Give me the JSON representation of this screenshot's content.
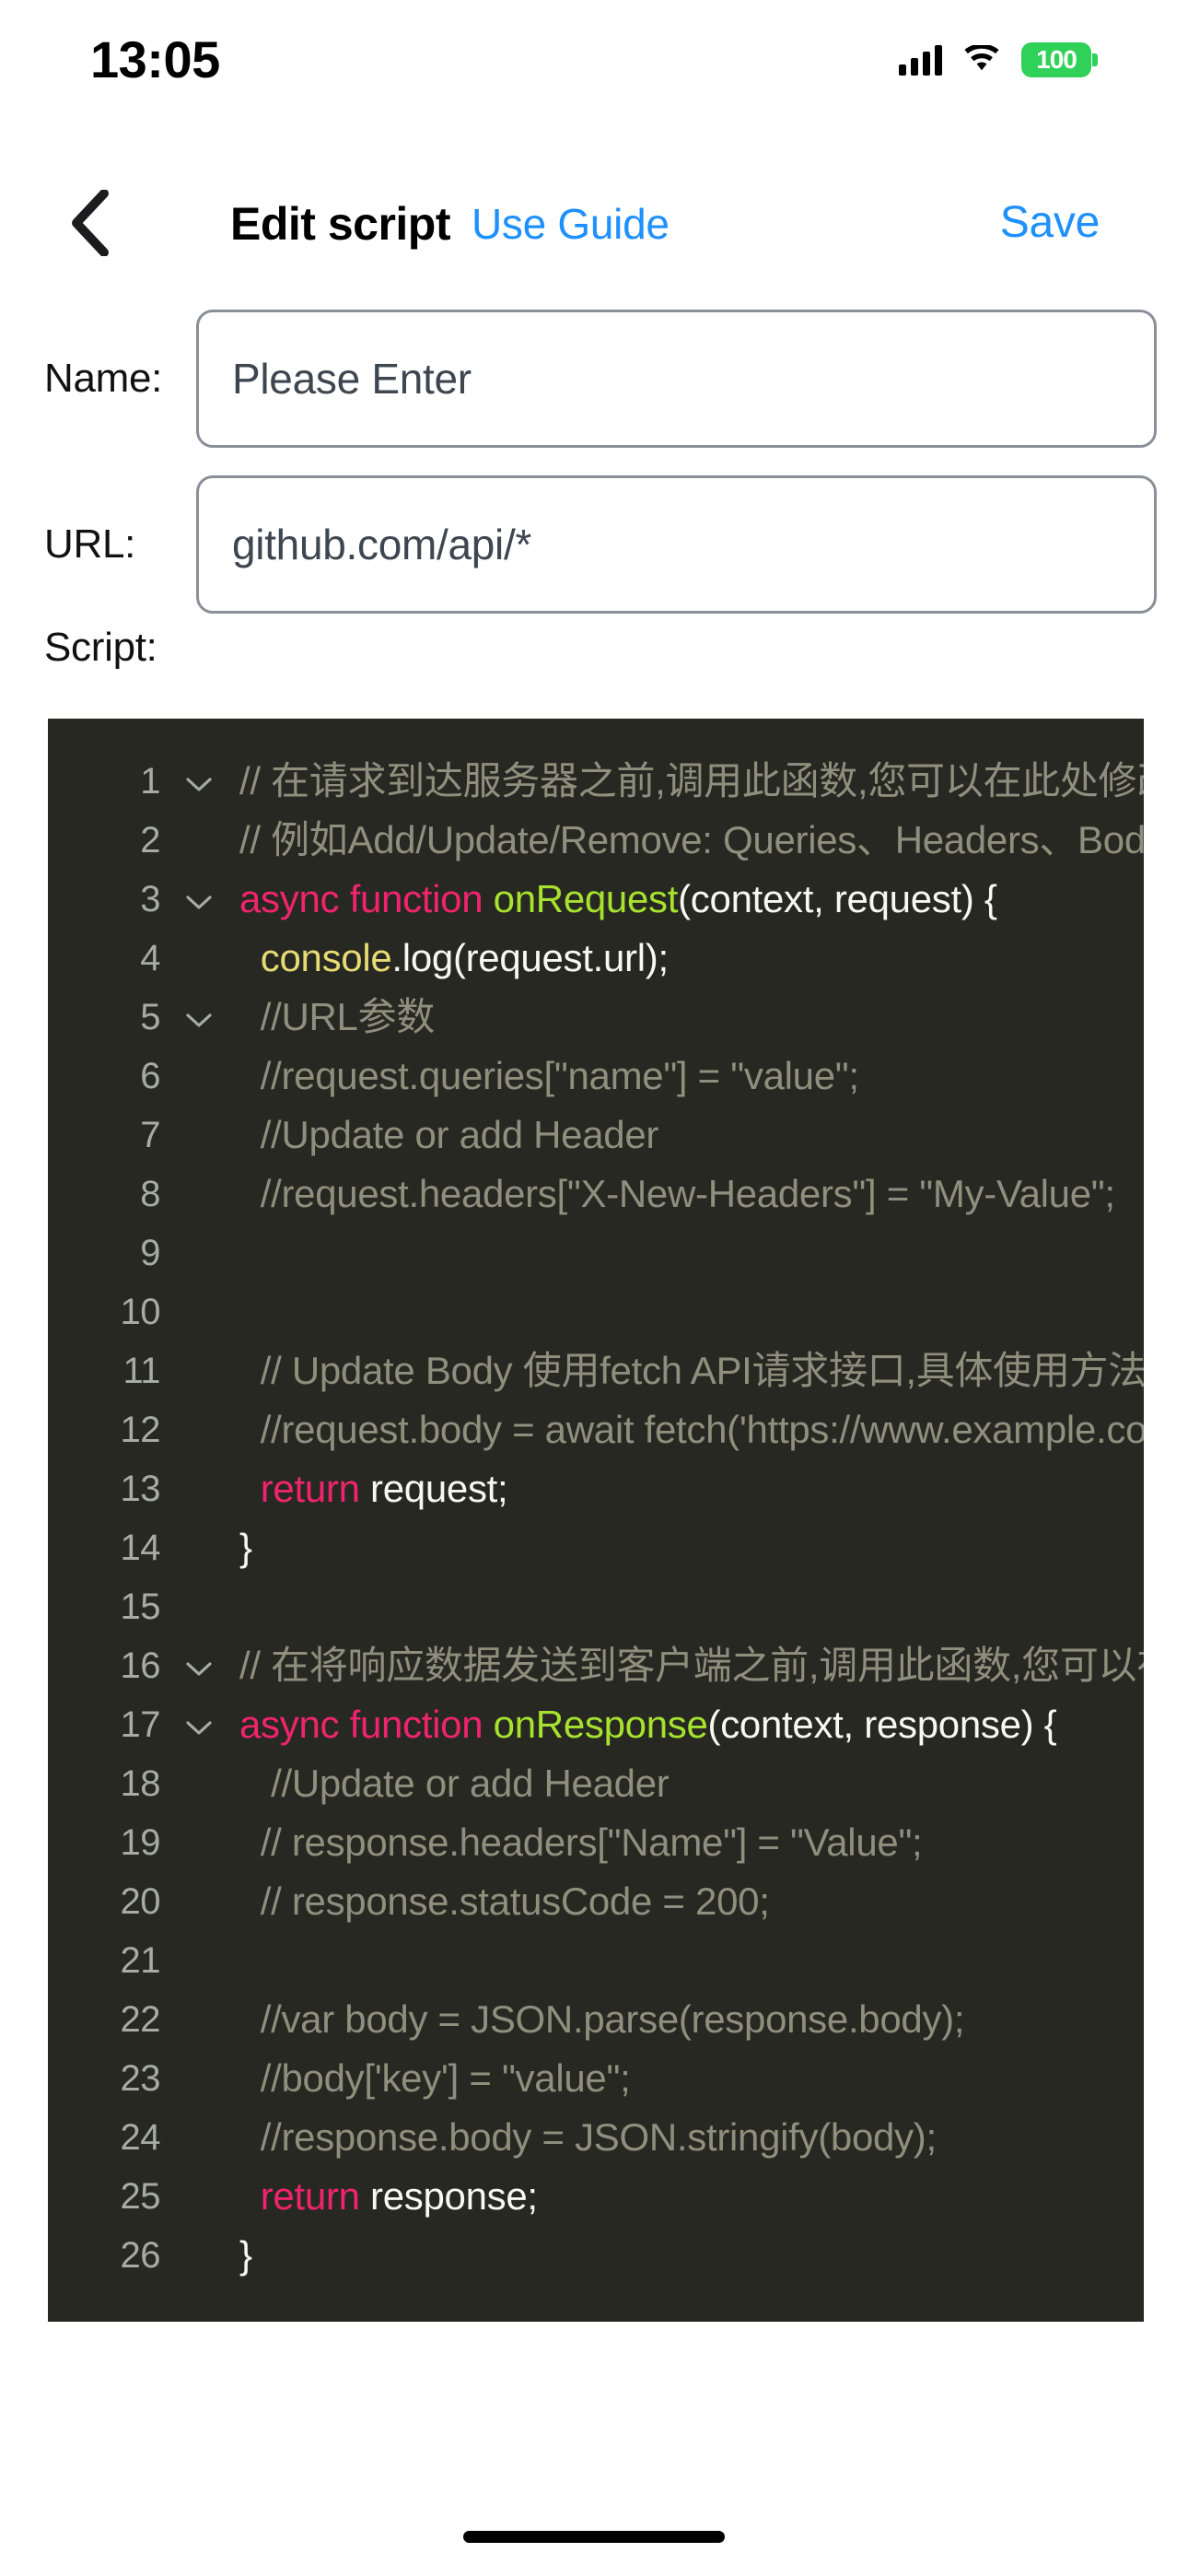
{
  "status_bar": {
    "time": "13:05",
    "battery_level": "100",
    "battery_color": "#30D158",
    "signal_icon": "cellular-signal-icon",
    "wifi_icon": "wifi-icon"
  },
  "nav": {
    "back_icon": "back-chevron-icon",
    "title": "Edit script",
    "guide_link": "Use Guide",
    "save_label": "Save",
    "accent_color": "#1E90FF"
  },
  "form": {
    "name": {
      "label": "Name:",
      "value": "Please Enter",
      "placeholder": "Please Enter"
    },
    "url": {
      "label": "URL:",
      "value": "github.com/api/*",
      "placeholder": "Please Enter"
    },
    "script_label": "Script:"
  },
  "editor": {
    "background": "#272822",
    "fold_icon": "chevron-down-icon",
    "lines": [
      {
        "n": "1",
        "fold": true,
        "tokens": [
          {
            "t": "// 在请求到达服务器之前,调用此函数,您可以在此处修改请求",
            "c": "comment"
          }
        ]
      },
      {
        "n": "2",
        "fold": false,
        "tokens": [
          {
            "t": "// 例如Add/Update/Remove: Queries、Headers、Body",
            "c": "comment"
          }
        ]
      },
      {
        "n": "3",
        "fold": true,
        "tokens": [
          {
            "t": "async function ",
            "c": "keyword"
          },
          {
            "t": "onRequest",
            "c": "fn"
          },
          {
            "t": "(context, request) {",
            "c": "plain"
          }
        ]
      },
      {
        "n": "4",
        "fold": false,
        "tokens": [
          {
            "t": "  ",
            "c": "plain"
          },
          {
            "t": "console",
            "c": "obj"
          },
          {
            "t": ".log(request.url);",
            "c": "plain"
          }
        ]
      },
      {
        "n": "5",
        "fold": true,
        "tokens": [
          {
            "t": "  //URL参数",
            "c": "comment"
          }
        ]
      },
      {
        "n": "6",
        "fold": false,
        "tokens": [
          {
            "t": "  //request.queries[\"name\"] = \"value\";",
            "c": "comment"
          }
        ]
      },
      {
        "n": "7",
        "fold": false,
        "tokens": [
          {
            "t": "  //Update or add Header",
            "c": "comment"
          }
        ]
      },
      {
        "n": "8",
        "fold": false,
        "tokens": [
          {
            "t": "  //request.headers[\"X-New-Headers\"] = \"My-Value\";",
            "c": "comment"
          }
        ]
      },
      {
        "n": "9",
        "fold": false,
        "tokens": [
          {
            "t": "",
            "c": "plain"
          }
        ]
      },
      {
        "n": "10",
        "fold": false,
        "tokens": [
          {
            "t": "",
            "c": "plain"
          }
        ]
      },
      {
        "n": "11",
        "fold": false,
        "tokens": [
          {
            "t": "  // Update Body 使用fetch API请求接口,具体使用方法请参考文档",
            "c": "comment"
          }
        ]
      },
      {
        "n": "12",
        "fold": false,
        "tokens": [
          {
            "t": "  //request.body = await fetch('https://www.example.com');",
            "c": "comment"
          }
        ]
      },
      {
        "n": "13",
        "fold": false,
        "tokens": [
          {
            "t": "  ",
            "c": "plain"
          },
          {
            "t": "return",
            "c": "keyword"
          },
          {
            "t": " request;",
            "c": "plain"
          }
        ]
      },
      {
        "n": "14",
        "fold": false,
        "tokens": [
          {
            "t": "}",
            "c": "plain"
          }
        ]
      },
      {
        "n": "15",
        "fold": false,
        "tokens": [
          {
            "t": "",
            "c": "plain"
          }
        ]
      },
      {
        "n": "16",
        "fold": true,
        "tokens": [
          {
            "t": "// 在将响应数据发送到客户端之前,调用此函数,您可以在此处修改响应",
            "c": "comment"
          }
        ]
      },
      {
        "n": "17",
        "fold": true,
        "tokens": [
          {
            "t": "async function ",
            "c": "keyword"
          },
          {
            "t": "onResponse",
            "c": "fn"
          },
          {
            "t": "(context, response) {",
            "c": "plain"
          }
        ]
      },
      {
        "n": "18",
        "fold": false,
        "tokens": [
          {
            "t": "   //Update or add Header",
            "c": "comment"
          }
        ]
      },
      {
        "n": "19",
        "fold": false,
        "tokens": [
          {
            "t": "  // response.headers[\"Name\"] = \"Value\";",
            "c": "comment"
          }
        ]
      },
      {
        "n": "20",
        "fold": false,
        "tokens": [
          {
            "t": "  // response.statusCode = 200;",
            "c": "comment"
          }
        ]
      },
      {
        "n": "21",
        "fold": false,
        "tokens": [
          {
            "t": "",
            "c": "plain"
          }
        ]
      },
      {
        "n": "22",
        "fold": false,
        "tokens": [
          {
            "t": "  //var body = JSON.parse(response.body);",
            "c": "comment"
          }
        ]
      },
      {
        "n": "23",
        "fold": false,
        "tokens": [
          {
            "t": "  //body['key'] = \"value\";",
            "c": "comment"
          }
        ]
      },
      {
        "n": "24",
        "fold": false,
        "tokens": [
          {
            "t": "  //response.body = JSON.stringify(body);",
            "c": "comment"
          }
        ]
      },
      {
        "n": "25",
        "fold": false,
        "tokens": [
          {
            "t": "  ",
            "c": "plain"
          },
          {
            "t": "return",
            "c": "keyword"
          },
          {
            "t": " response;",
            "c": "plain"
          }
        ]
      },
      {
        "n": "26",
        "fold": false,
        "tokens": [
          {
            "t": "}",
            "c": "plain"
          }
        ]
      }
    ]
  }
}
